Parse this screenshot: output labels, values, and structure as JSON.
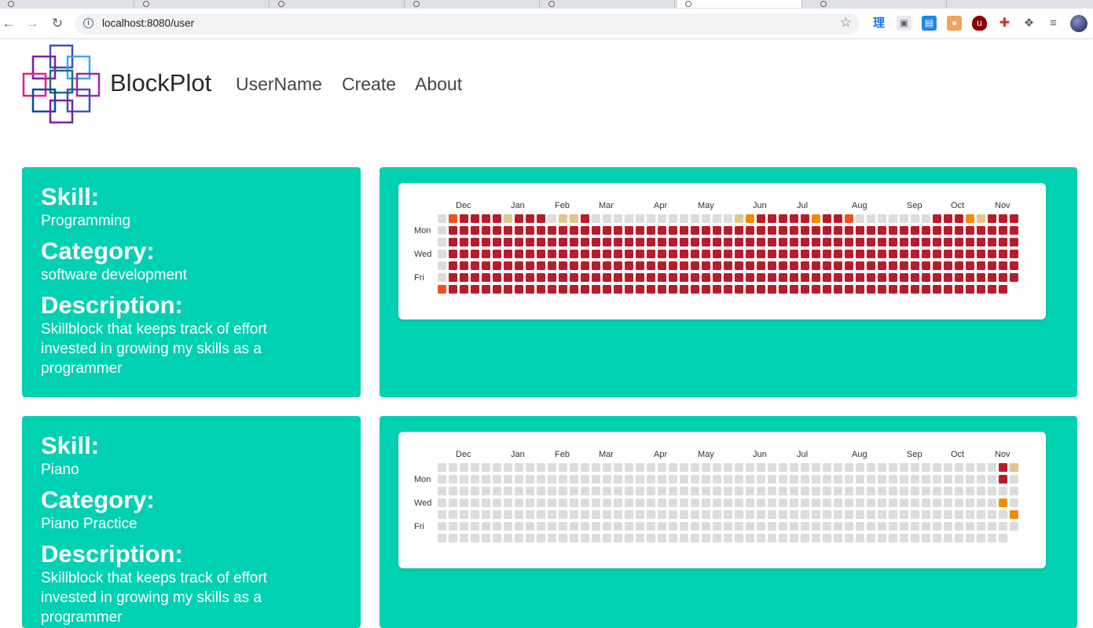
{
  "browser": {
    "url": "localhost:8080/user",
    "tabs_count": 7
  },
  "site": {
    "brand": "BlockPlot",
    "nav": [
      "UserName",
      "Create",
      "About"
    ],
    "logo_colors": [
      "#3f51b5",
      "#7b1fa2",
      "#42a5f5",
      "#e91e8c",
      "#1b6f8a",
      "#9c27b0",
      "#0d47a1"
    ]
  },
  "labels": {
    "skill": "Skill:",
    "category": "Category:",
    "description": "Description:"
  },
  "heatmap": {
    "months": [
      "Dec",
      "Jan",
      "Feb",
      "Mar",
      "Apr",
      "May",
      "Jun",
      "Jul",
      "Aug",
      "Sep",
      "Oct",
      "Nov"
    ],
    "days": [
      "Mon",
      "Wed",
      "Fri"
    ],
    "weeks": 53,
    "legend_colors": {
      "0": "#dcdcdc",
      "1": "#dfc58f",
      "2": "#ef8c00",
      "3": "#f4511e",
      "4": "#b71c2c"
    }
  },
  "skills": [
    {
      "skill": "Programming",
      "category": "software development",
      "description": "Skillblock that keeps track of effort invested in growing my skills as a programmer",
      "chart_data": {
        "type": "heatmap",
        "rows": [
          "03444414440114000000000000012444442443000000044421444444443443",
          "04444444444444444444444444444444444444444444444444444444444444",
          "04444444444444444444444444444444444444444444444444444444444444",
          "04444444444444444444444444444444444444444444444444444444444444",
          "04444444444444444444444444444444444444444444444444444444444444",
          "04444444444444444444444444444444444444444444444444444444444444",
          "34444444444444444444444444444444444444444444444444444444444444"
        ]
      }
    },
    {
      "skill": "Piano",
      "category": "Piano Practice",
      "description": "Skillblock that keeps track of effort invested in growing my skills as a programmer",
      "chart_data": {
        "type": "heatmap",
        "rows": [
          "00000000000000000000000000000000000000000000000000041",
          "0000000000000000000000000000000000000000000000000004",
          "0000000000000000000000000000000000000000000000000000",
          "00000000000000000000000000000000000000000000000000020",
          "000000000000000000000000000000000000000000000000000020",
          "0000000000000000000000000000000000000000000000000000",
          "0000000000000000000000000000000000000000000000000000"
        ]
      }
    }
  ]
}
